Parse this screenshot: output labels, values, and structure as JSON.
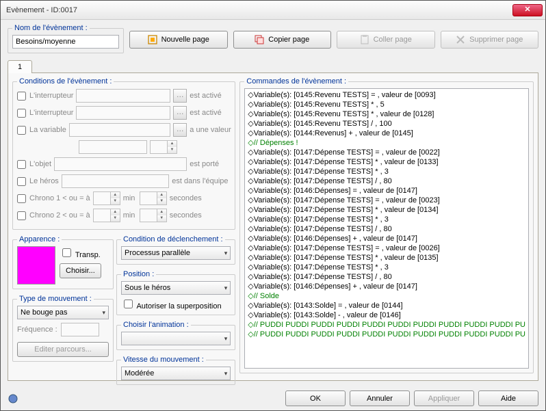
{
  "window": {
    "title": "Evènement - ID:0017"
  },
  "name_section": {
    "legend": "Nom de l'évènement :",
    "value": "Besoins/moyenne"
  },
  "top_buttons": {
    "new_page": "Nouvelle page",
    "copy_page": "Copier page",
    "paste_page": "Coller page",
    "delete_page": "Supprimer page"
  },
  "tab_label": "1",
  "conditions": {
    "legend": "Conditions de l'évènement :",
    "switch1_label": "L'interrupteur",
    "switch1_suffix": "est activé",
    "switch2_label": "L'interrupteur",
    "switch2_suffix": "est activé",
    "var_label": "La variable",
    "var_suffix": "a une valeur",
    "item_label": "L'objet",
    "item_suffix": "est porté",
    "hero_label": "Le héros",
    "hero_suffix": "est dans l'équipe",
    "chrono1_label": "Chrono 1 < ou = à",
    "min": "min",
    "sec": "secondes",
    "chrono2_label": "Chrono 2 < ou = à"
  },
  "appearance": {
    "legend": "Apparence :",
    "transp": "Transp.",
    "choose": "Choisir..."
  },
  "trigger": {
    "legend": "Condition de déclenchement :",
    "value": "Processus parallèle"
  },
  "position": {
    "legend": "Position :",
    "value": "Sous le héros",
    "overlap": "Autoriser la superposition"
  },
  "anim": {
    "legend": "Choisir l'animation :",
    "value": ""
  },
  "speed": {
    "legend": "Vitesse du mouvement :",
    "value": "Modérée"
  },
  "movement": {
    "legend": "Type de mouvement :",
    "value": "Ne bouge pas",
    "freq_label": "Fréquence :",
    "edit": "Editer parcours..."
  },
  "commands_legend": "Commandes de l'évènement :",
  "commands": [
    {
      "t": "◇Variable(s): [0145:Revenu TESTS] = , valeur de [0093]",
      "c": ""
    },
    {
      "t": "◇Variable(s): [0145:Revenu TESTS] * , 5",
      "c": ""
    },
    {
      "t": "◇Variable(s): [0145:Revenu TESTS] * , valeur de [0128]",
      "c": ""
    },
    {
      "t": "◇Variable(s): [0145:Revenu TESTS] / , 100",
      "c": ""
    },
    {
      "t": "◇Variable(s): [0144:Revenus] + , valeur de [0145]",
      "c": ""
    },
    {
      "t": "◇// Dépenses !",
      "c": "green"
    },
    {
      "t": "◇Variable(s): [0147:Dépense TESTS] = , valeur de [0022]",
      "c": ""
    },
    {
      "t": "◇Variable(s): [0147:Dépense TESTS] * , valeur de [0133]",
      "c": ""
    },
    {
      "t": "◇Variable(s): [0147:Dépense TESTS] * , 3",
      "c": ""
    },
    {
      "t": "◇Variable(s): [0147:Dépense TESTS] / , 80",
      "c": ""
    },
    {
      "t": "◇Variable(s): [0146:Dépenses] = , valeur de [0147]",
      "c": ""
    },
    {
      "t": "◇Variable(s): [0147:Dépense TESTS] = , valeur de [0023]",
      "c": ""
    },
    {
      "t": "◇Variable(s): [0147:Dépense TESTS] * , valeur de [0134]",
      "c": ""
    },
    {
      "t": "◇Variable(s): [0147:Dépense TESTS] * , 3",
      "c": ""
    },
    {
      "t": "◇Variable(s): [0147:Dépense TESTS] / , 80",
      "c": ""
    },
    {
      "t": "◇Variable(s): [0146:Dépenses] + , valeur de [0147]",
      "c": ""
    },
    {
      "t": "◇Variable(s): [0147:Dépense TESTS] = , valeur de [0026]",
      "c": ""
    },
    {
      "t": "◇Variable(s): [0147:Dépense TESTS] * , valeur de [0135]",
      "c": ""
    },
    {
      "t": "◇Variable(s): [0147:Dépense TESTS] * , 3",
      "c": ""
    },
    {
      "t": "◇Variable(s): [0147:Dépense TESTS] / , 80",
      "c": ""
    },
    {
      "t": "◇Variable(s): [0146:Dépenses] + , valeur de [0147]",
      "c": ""
    },
    {
      "t": "◇// Solde",
      "c": "green"
    },
    {
      "t": "◇Variable(s): [0143:Solde] = , valeur de [0144]",
      "c": ""
    },
    {
      "t": "◇Variable(s): [0143:Solde] - , valeur de [0146]",
      "c": ""
    },
    {
      "t": "◇// PUDDI PUDDI PUDDI PUDDI PUDDI PUDDI PUDDI PUDDI PUDDI PUDDI PU",
      "c": "green"
    },
    {
      "t": "◇// PUDDI PUDDI PUDDI PUDDI PUDDI PUDDI PUDDI PUDDI PUDDI PUDDI PU",
      "c": "green"
    }
  ],
  "footer": {
    "ok": "OK",
    "cancel": "Annuler",
    "apply": "Appliquer",
    "help": "Aide"
  }
}
